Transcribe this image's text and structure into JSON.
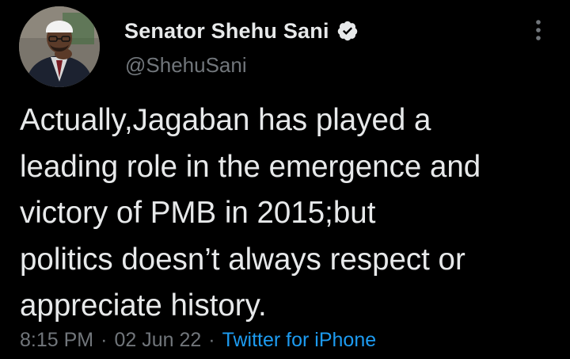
{
  "author": {
    "display_name": "Senator Shehu Sani",
    "handle": "@ShehuSani",
    "verified": true,
    "avatar_icon": "profile-photo"
  },
  "tweet": {
    "text": "Actually,Jagaban has played a\nleading role in the emergence and\nvictory of PMB in 2015;but\npolitics doesn’t always respect or\nappreciate history.",
    "time": "8:15 PM",
    "separator": "·",
    "date": "02 Jun 22",
    "source": "Twitter for iPhone"
  },
  "icons": {
    "verified": "verified-badge-icon",
    "more": "more-options-icon"
  },
  "colors": {
    "background": "#000000",
    "primary_text": "#e7e9ea",
    "secondary_text": "#71767b",
    "accent": "#1d9bf0"
  }
}
